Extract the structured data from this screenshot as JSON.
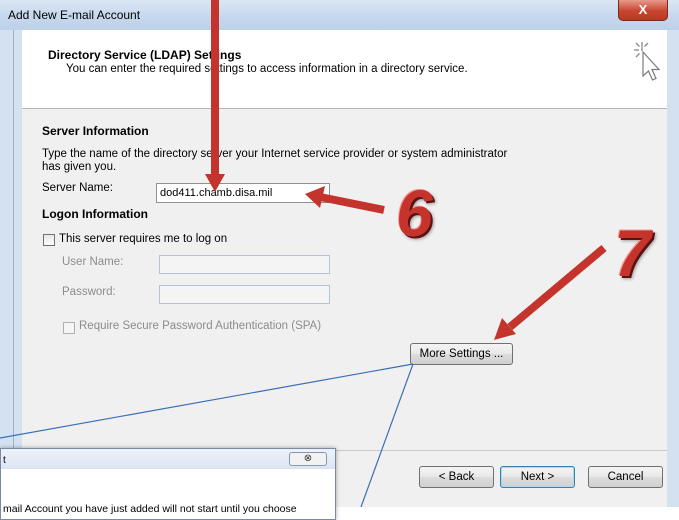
{
  "window": {
    "title": "Add New E-mail Account",
    "close_glyph": "X"
  },
  "header": {
    "title": "Directory Service (LDAP) Settings",
    "subtitle": "You can enter the required settings to access information in a directory service.",
    "icon": "cursor-sparkle-icon"
  },
  "server_info": {
    "heading": "Server Information",
    "description_line1": "Type the name of the directory server your Internet service provider or system administrator",
    "description_line2": "has given you.",
    "server_name_label": "Server Name:",
    "server_name_value": "dod411.chamb.disa.mil"
  },
  "logon_info": {
    "heading": "Logon Information",
    "requires_logon_label": "This server requires me to log on",
    "requires_logon_checked": false,
    "user_name_label": "User Name:",
    "user_name_value": "",
    "password_label": "Password:",
    "password_value": "",
    "spa_label": "Require Secure Password Authentication (SPA)",
    "spa_checked": false
  },
  "buttons": {
    "more_settings": "More Settings ...",
    "back": "< Back",
    "next": "Next >",
    "cancel": "Cancel"
  },
  "annotations": {
    "step6": "6",
    "step7": "7",
    "arrow_color": "#c4342d",
    "line_color": "#3a6fb5"
  },
  "popup": {
    "title_fragment": "t",
    "close_glyph": "⊗",
    "text": "mail Account you have just added will not start until you choose"
  }
}
